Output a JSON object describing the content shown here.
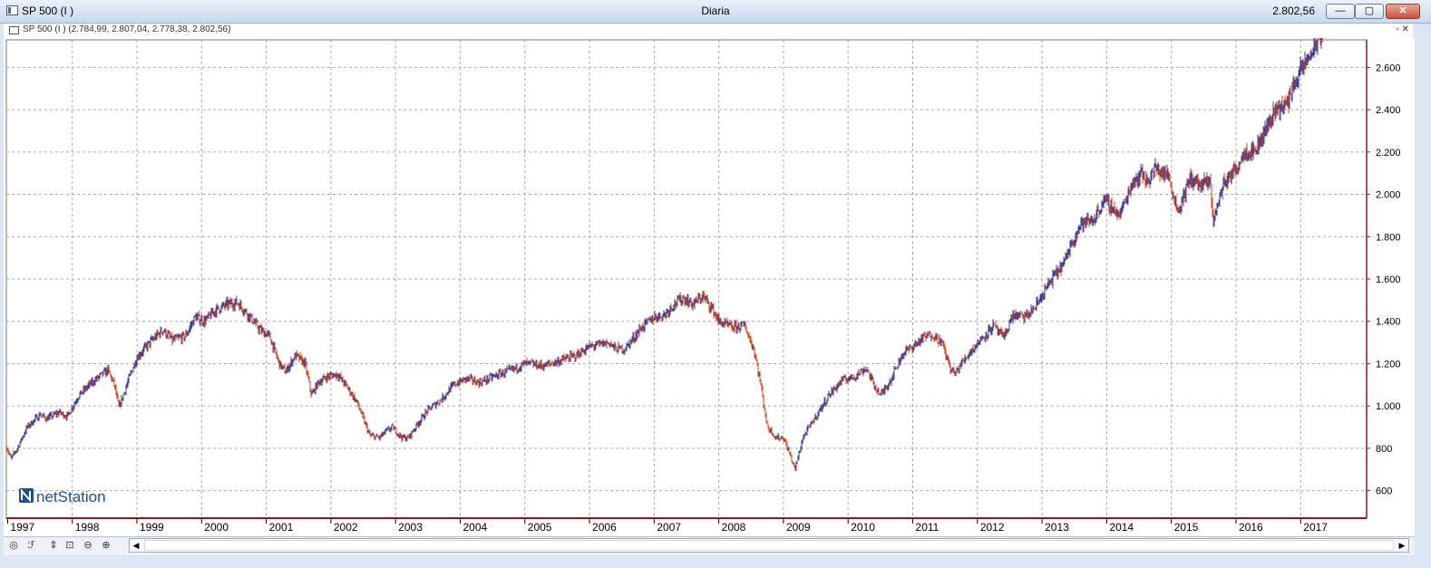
{
  "window": {
    "title": "SP 500 (I )",
    "center_label": "Diaria",
    "last_price": "2.802,56",
    "min_glyph": "—",
    "max_glyph": "▢",
    "close_glyph": "✕"
  },
  "series_bar": {
    "label": "SP 500 (I ) (2.784,99, 2.807,04, 2.778,38, 2.802,56)",
    "right_controls": "▫ ✕"
  },
  "colors": {
    "up": "#2f3fa0",
    "down": "#d0461a",
    "grid": "#a9a9a9",
    "axis": "#8b1a1a",
    "price_tag_bg": "#2c3f86",
    "logo": "#1f4f8f"
  },
  "logo": {
    "text": "netStation"
  },
  "toolbar": {
    "icons": [
      "crosshair-icon",
      "indicator-icon",
      "drag-icon",
      "zoom-fit-icon",
      "zoom-out-icon",
      "zoom-in-icon"
    ],
    "scroll_left": "◀",
    "scroll_right": "▶"
  },
  "chart_data": {
    "type": "line",
    "style": "ohlc-bars",
    "title": "",
    "xlabel": "",
    "ylabel": "",
    "x_tick_labels": [
      "1997",
      "1998",
      "1999",
      "2000",
      "2001",
      "2002",
      "2003",
      "2004",
      "2005",
      "2006",
      "2007",
      "2008",
      "2009",
      "2010",
      "2011",
      "2012",
      "2013",
      "2014",
      "2015",
      "2016",
      "2017"
    ],
    "y_ticks": [
      600,
      800,
      1000,
      1200,
      1400,
      1600,
      1800,
      2000,
      2200,
      2400,
      2600
    ],
    "y_tick_labels": [
      "600",
      "800",
      "1.000",
      "1.200",
      "1.400",
      "1.600",
      "1.800",
      "2.000",
      "2.200",
      "2.400",
      "2.600"
    ],
    "ylim": [
      470,
      2730
    ],
    "xlim": [
      1996.98,
      2018.02
    ],
    "grid": true,
    "last_value": 2802.56,
    "last_value_label": "2.802,56",
    "x": [
      1996.98,
      1997.05,
      1997.15,
      1997.3,
      1997.5,
      1997.6,
      1997.8,
      1997.92,
      1998.1,
      1998.3,
      1998.55,
      1998.65,
      1998.72,
      1998.9,
      1999.0,
      1999.2,
      1999.4,
      1999.55,
      1999.75,
      1999.9,
      2000.05,
      2000.2,
      2000.4,
      2000.55,
      2000.7,
      2000.9,
      2001.05,
      2001.2,
      2001.3,
      2001.45,
      2001.6,
      2001.7,
      2001.8,
      2001.95,
      2002.1,
      2002.25,
      2002.4,
      2002.55,
      2002.6,
      2002.75,
      2002.85,
      2002.95,
      2003.1,
      2003.2,
      2003.35,
      2003.5,
      2003.7,
      2003.9,
      2004.1,
      2004.3,
      2004.6,
      2004.8,
      2005.0,
      2005.3,
      2005.5,
      2005.8,
      2006.0,
      2006.3,
      2006.4,
      2006.55,
      2006.8,
      2007.0,
      2007.15,
      2007.3,
      2007.45,
      2007.6,
      2007.75,
      2007.9,
      2008.0,
      2008.2,
      2008.4,
      2008.55,
      2008.65,
      2008.75,
      2008.82,
      2008.88,
      2009.0,
      2009.1,
      2009.18,
      2009.3,
      2009.5,
      2009.7,
      2009.9,
      2010.1,
      2010.28,
      2010.4,
      2010.5,
      2010.65,
      2010.85,
      2011.0,
      2011.15,
      2011.3,
      2011.45,
      2011.58,
      2011.65,
      2011.75,
      2011.9,
      2012.1,
      2012.25,
      2012.4,
      2012.55,
      2012.75,
      2012.9,
      2013.05,
      2013.2,
      2013.35,
      2013.45,
      2013.6,
      2013.8,
      2013.95,
      2014.05,
      2014.2,
      2014.4,
      2014.55,
      2014.62,
      2014.75,
      2014.95,
      2015.1,
      2015.3,
      2015.45,
      2015.6,
      2015.65,
      2015.8,
      2015.95,
      2016.05,
      2016.12,
      2016.3,
      2016.45,
      2016.6,
      2016.8,
      2016.87,
      2017.0,
      2017.2,
      2017.4,
      2017.6,
      2017.8,
      2017.95,
      2018.02
    ],
    "values": [
      810,
      750,
      800,
      900,
      960,
      940,
      970,
      950,
      1050,
      1110,
      1170,
      1100,
      990,
      1150,
      1230,
      1300,
      1360,
      1310,
      1330,
      1420,
      1400,
      1450,
      1480,
      1490,
      1440,
      1360,
      1330,
      1200,
      1160,
      1240,
      1200,
      1050,
      1110,
      1140,
      1150,
      1090,
      1020,
      900,
      860,
      850,
      880,
      900,
      850,
      850,
      920,
      980,
      1030,
      1100,
      1130,
      1110,
      1150,
      1170,
      1200,
      1190,
      1210,
      1240,
      1280,
      1300,
      1270,
      1270,
      1370,
      1420,
      1430,
      1480,
      1510,
      1480,
      1520,
      1460,
      1400,
      1370,
      1380,
      1260,
      1100,
      900,
      880,
      850,
      850,
      770,
      700,
      850,
      950,
      1050,
      1120,
      1140,
      1180,
      1100,
      1050,
      1120,
      1250,
      1280,
      1320,
      1340,
      1300,
      1180,
      1150,
      1200,
      1260,
      1330,
      1380,
      1320,
      1430,
      1420,
      1470,
      1550,
      1620,
      1680,
      1770,
      1860,
      1880,
      1970,
      1950,
      1900,
      2060,
      2100,
      2060,
      2120,
      2090,
      1920,
      2080,
      2040,
      2060,
      1870,
      2050,
      2100,
      2150,
      2200,
      2210,
      2300,
      2400,
      2430,
      2510,
      2580,
      2690,
      2802.56
    ]
  }
}
